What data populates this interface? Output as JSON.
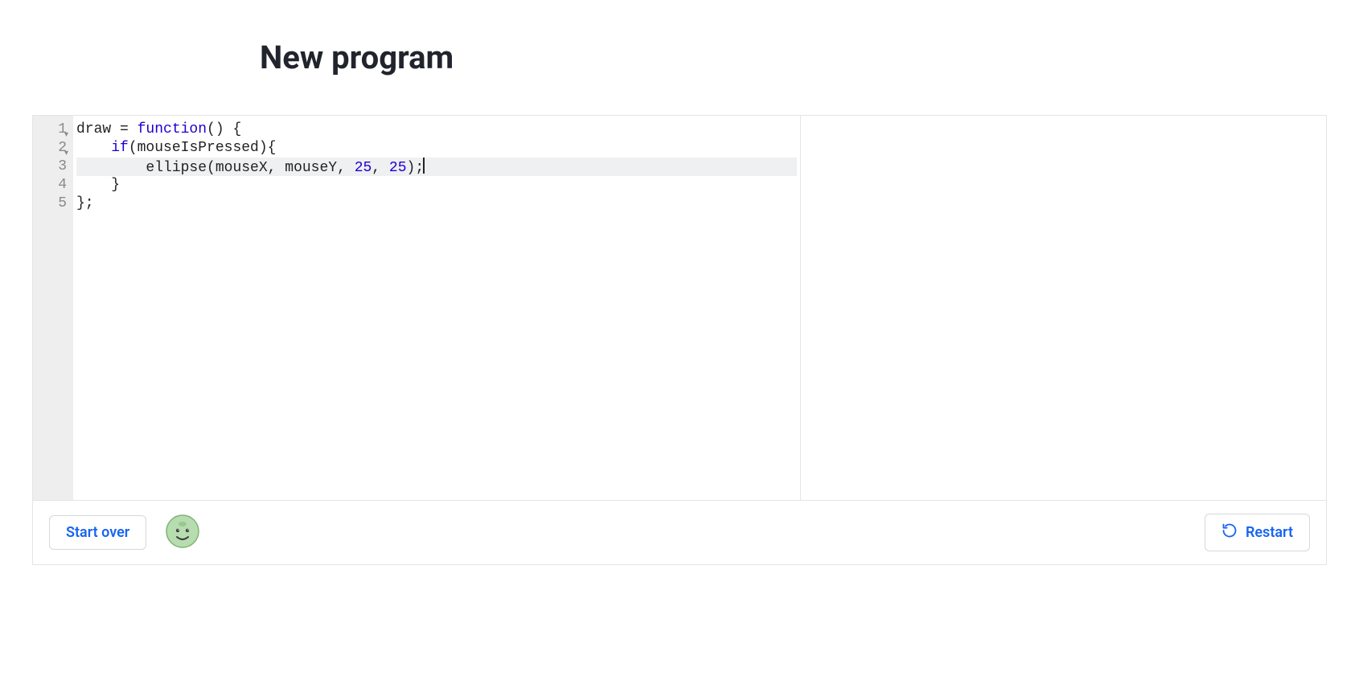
{
  "header": {
    "title": "New program"
  },
  "editor": {
    "active_line_index": 2,
    "lines": [
      {
        "num": "1",
        "foldable": true,
        "tokens": [
          {
            "cls": "tok-ident",
            "text": "draw"
          },
          {
            "cls": "tok-default",
            "text": " = "
          },
          {
            "cls": "tok-keyword",
            "text": "function"
          },
          {
            "cls": "tok-default",
            "text": "() {"
          }
        ]
      },
      {
        "num": "2",
        "foldable": true,
        "indent": "    ",
        "tokens": [
          {
            "cls": "tok-keyword",
            "text": "if"
          },
          {
            "cls": "tok-default",
            "text": "(mouseIsPressed){"
          }
        ]
      },
      {
        "num": "3",
        "foldable": false,
        "indent": "        ",
        "tokens": [
          {
            "cls": "tok-ident",
            "text": "ellipse"
          },
          {
            "cls": "tok-default",
            "text": "(mouseX, mouseY, "
          },
          {
            "cls": "tok-number",
            "text": "25"
          },
          {
            "cls": "tok-default",
            "text": ", "
          },
          {
            "cls": "tok-number",
            "text": "25"
          },
          {
            "cls": "tok-default",
            "text": ");"
          }
        ],
        "cursor_after": true
      },
      {
        "num": "4",
        "foldable": false,
        "indent": "    ",
        "tokens": [
          {
            "cls": "tok-default",
            "text": "}"
          }
        ]
      },
      {
        "num": "5",
        "foldable": false,
        "tokens": [
          {
            "cls": "tok-default",
            "text": "};"
          }
        ]
      }
    ]
  },
  "toolbar": {
    "start_over_label": "Start over",
    "restart_label": "Restart"
  }
}
